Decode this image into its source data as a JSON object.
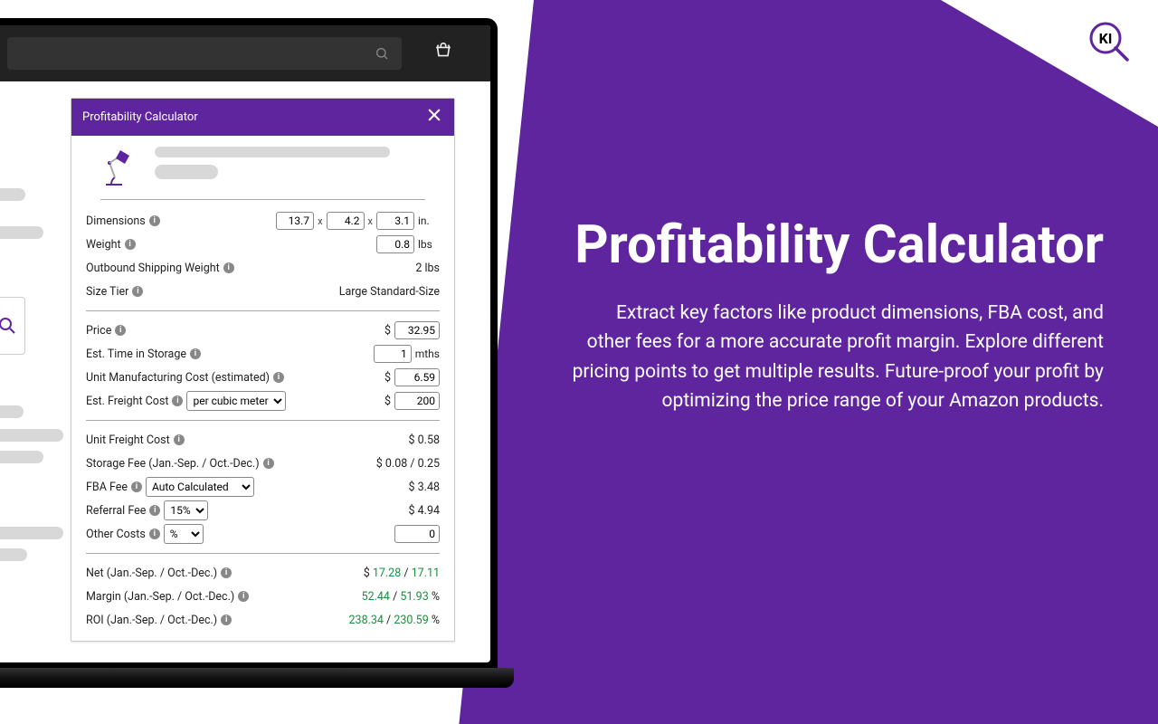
{
  "logo_text": "KI",
  "calc": {
    "title": "Profitability Calculator",
    "dimensions": {
      "label": "Dimensions",
      "l": "13.7",
      "w": "4.2",
      "h": "3.1",
      "unit": "in."
    },
    "weight": {
      "label": "Weight",
      "value": "0.8",
      "unit": "lbs"
    },
    "outbound": {
      "label": "Outbound Shipping Weight",
      "value": "2 lbs"
    },
    "sizetier": {
      "label": "Size Tier",
      "value": "Large Standard-Size"
    },
    "price": {
      "label": "Price",
      "currency": "$",
      "value": "32.95"
    },
    "storage_time": {
      "label": "Est. Time in Storage",
      "value": "1",
      "unit": "mths"
    },
    "unit_mfg": {
      "label": "Unit Manufacturing Cost (estimated)",
      "currency": "$",
      "value": "6.59"
    },
    "freight": {
      "label": "Est. Freight Cost",
      "select": "per cubic meter",
      "currency": "$",
      "value": "200"
    },
    "unit_freight": {
      "label": "Unit Freight Cost",
      "value": "$ 0.58"
    },
    "storage_fee": {
      "label": "Storage Fee (Jan.-Sep. / Oct.-Dec.)",
      "value": "$ 0.08 / 0.25"
    },
    "fba": {
      "label": "FBA Fee",
      "select": "Auto Calculated",
      "value": "$ 3.48"
    },
    "referral": {
      "label": "Referral Fee",
      "select": "15%",
      "value": "$ 4.94"
    },
    "other": {
      "label": "Other Costs",
      "select": "%",
      "value": "0"
    },
    "net": {
      "label": "Net (Jan.-Sep. / Oct.-Dec.)",
      "prefix": "$ ",
      "v1": "17.28",
      "sep": " / ",
      "v2": "17.11"
    },
    "margin": {
      "label": "Margin (Jan.-Sep. / Oct.-Dec.)",
      "v1": "52.44",
      "sep": " / ",
      "v2": "51.93",
      "suffix": " %"
    },
    "roi": {
      "label": "ROI (Jan.-Sep. / Oct.-Dec.)",
      "v1": "238.34",
      "sep": " / ",
      "v2": "230.59",
      "suffix": " %"
    }
  },
  "marketing": {
    "title": "Profitability Calculator",
    "body": "Extract key factors like product dimensions, FBA cost, and other fees for a more accurate profit margin. Explore different pricing points to get multiple results. Future-proof your profit by optimizing the price range of your Amazon products."
  }
}
